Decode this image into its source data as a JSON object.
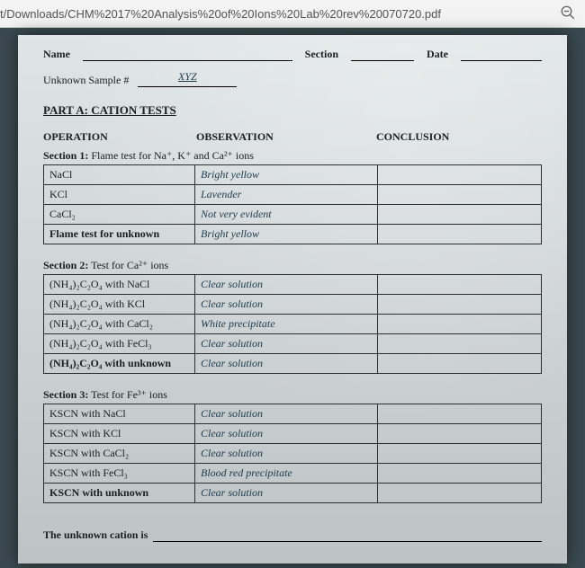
{
  "toolbar": {
    "url": "t/Downloads/CHM%2017%20Analysis%20of%20Ions%20Lab%20rev%20070720.pdf"
  },
  "header": {
    "name_label": "Name",
    "section_label": "Section",
    "date_label": "Date",
    "sample_label": "Unknown Sample #",
    "sample_value": "XYZ"
  },
  "part_a_title": "PART A:  CATION TESTS",
  "columns": {
    "operation": "OPERATION",
    "observation": "OBSERVATION",
    "conclusion": "CONCLUSION"
  },
  "sections": [
    {
      "title_prefix": "Section 1:",
      "title_rest": "Flame test for Na⁺, K⁺ and Ca²⁺ ions",
      "rows": [
        {
          "op": "NaCl",
          "ob": "Bright yellow",
          "co": ""
        },
        {
          "op": "KCl",
          "ob": "Lavender",
          "co": ""
        },
        {
          "op": "CaCl₂",
          "ob": "Not very evident",
          "co": ""
        },
        {
          "op_unknown": "Flame test for unknown",
          "ob": "Bright yellow",
          "co": ""
        }
      ]
    },
    {
      "title_prefix": "Section 2:",
      "title_rest": "Test for Ca²⁺ ions",
      "rows": [
        {
          "op": "(NH₄)₂C₂O₄ with NaCl",
          "ob": "Clear solution",
          "co": ""
        },
        {
          "op": "(NH₄)₂C₂O₄ with KCl",
          "ob": "Clear solution",
          "co": ""
        },
        {
          "op": "(NH₄)₂C₂O₄ with CaCl₂",
          "ob": "White precipitate",
          "co": ""
        },
        {
          "op": "(NH₄)₂C₂O₄ with FeCl₃",
          "ob": "Clear solution",
          "co": ""
        },
        {
          "op_unknown": "(NH₄)₂C₂O₄ with unknown",
          "ob": "Clear solution",
          "co": ""
        }
      ]
    },
    {
      "title_prefix": "Section 3:",
      "title_rest": "Test for Fe³⁺ ions",
      "rows": [
        {
          "op": "KSCN with NaCl",
          "ob": "Clear solution",
          "co": ""
        },
        {
          "op": "KSCN with KCl",
          "ob": "Clear solution",
          "co": ""
        },
        {
          "op": "KSCN with CaCl₂",
          "ob": "Clear solution",
          "co": ""
        },
        {
          "op": "KSCN with FeCl₃",
          "ob": "Blood red precipitate",
          "co": ""
        },
        {
          "op_unknown": "KSCN with unknown",
          "ob": "Clear solution",
          "co": ""
        }
      ]
    }
  ],
  "final": {
    "label": "The unknown cation is",
    "value": ""
  }
}
